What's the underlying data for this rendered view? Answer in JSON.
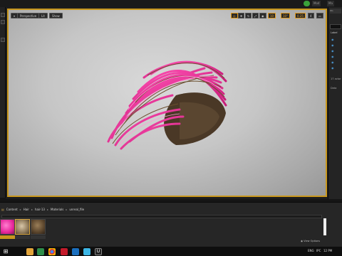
{
  "topbar": {
    "labels": [
      "Mod",
      "Ma"
    ]
  },
  "viewport": {
    "perspective_label": "Perspective",
    "lit_label": "Lit",
    "show_label": "Show",
    "snap_value_1": "10",
    "snap_value_2": "10°",
    "snap_value_3": "0.25",
    "camera_speed": "4"
  },
  "outliner": {
    "tab_label": "Wo",
    "column_label": "Label",
    "actor_count": "17 actor",
    "details_tab": "Deta"
  },
  "content_browser": {
    "breadcrumbs": [
      "Content",
      "Hair",
      "hair-13",
      "Materials",
      "unreal_file"
    ],
    "view_options": "View Options"
  },
  "taskbar": {
    "language": "ENG",
    "region": "IPC",
    "time": "12 PM"
  },
  "colors": {
    "accent": "#e39a1c",
    "hair_pink": "#e8278c",
    "hair_brown": "#5a4630",
    "play_green": "#3aa23a"
  }
}
